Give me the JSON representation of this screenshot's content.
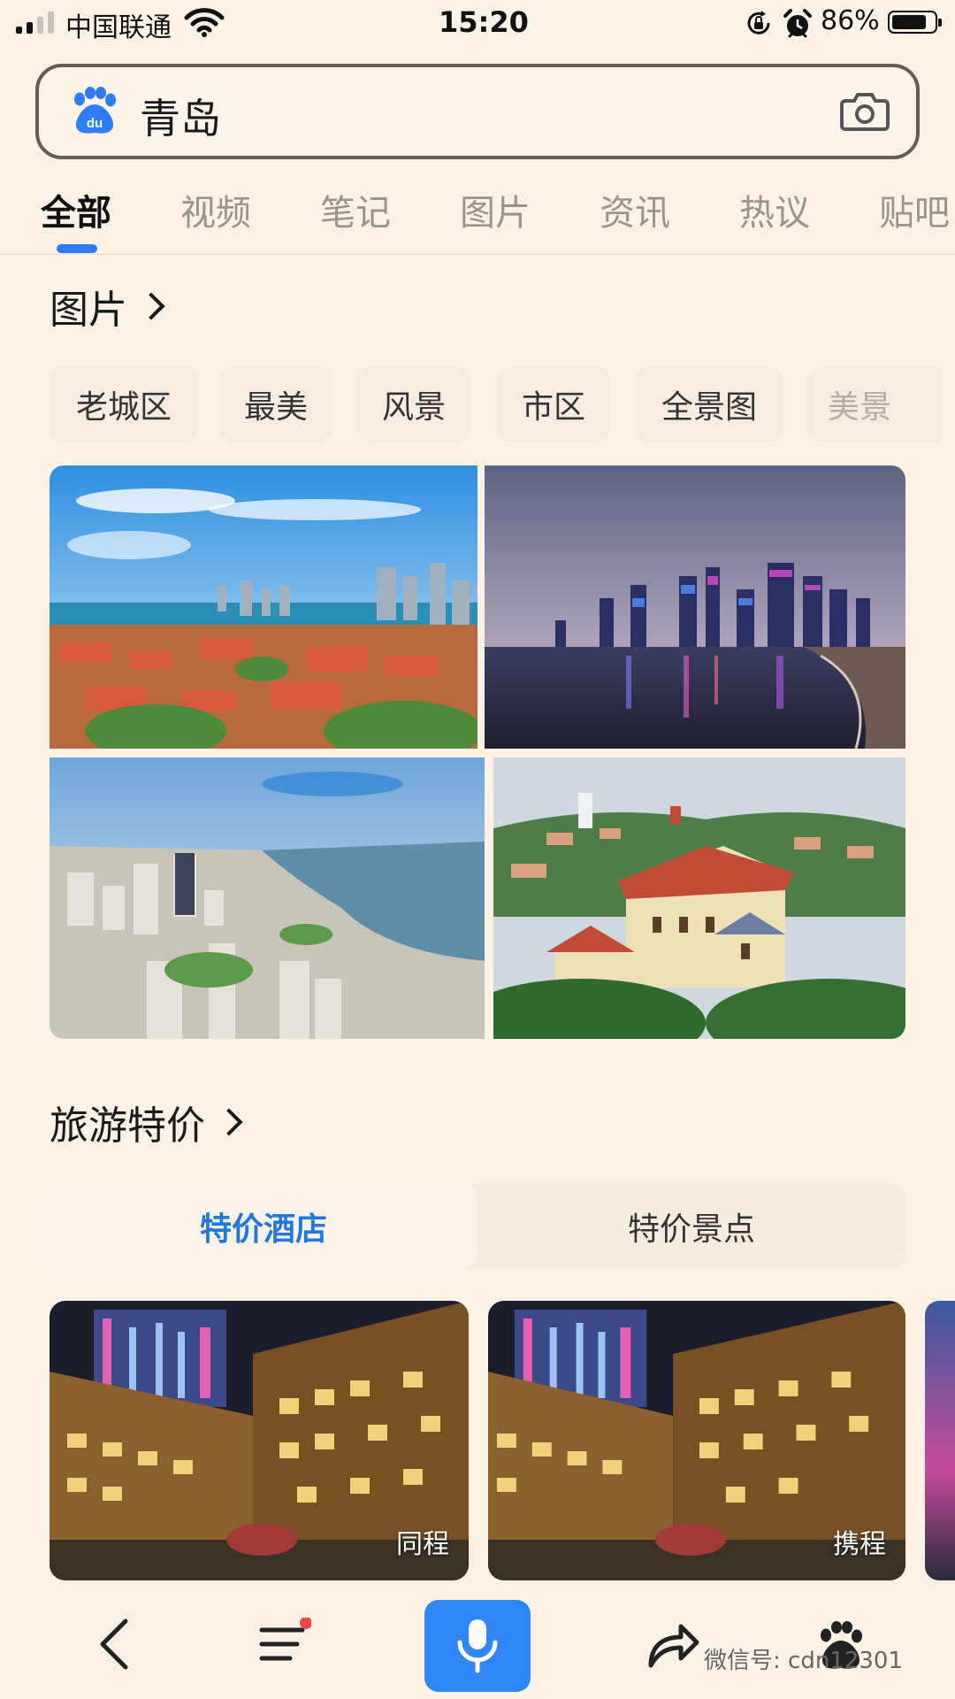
{
  "status_bar": {
    "carrier": "中国联通",
    "time": "15:20",
    "battery_percent": "86%",
    "battery_level": 0.86
  },
  "search": {
    "query": "青岛"
  },
  "tabs": [
    {
      "label": "全部",
      "active": true
    },
    {
      "label": "视频"
    },
    {
      "label": "笔记"
    },
    {
      "label": "图片"
    },
    {
      "label": "资讯"
    },
    {
      "label": "热议"
    },
    {
      "label": "贴吧"
    }
  ],
  "images_section": {
    "title": "图片",
    "chips": [
      "老城区",
      "最美",
      "风景",
      "市区",
      "全景图",
      "美景"
    ]
  },
  "travel_section": {
    "title": "旅游特价",
    "tabs": [
      {
        "label": "特价酒店",
        "active": true
      },
      {
        "label": "特价景点"
      }
    ],
    "hotels": [
      {
        "provider": "同程"
      },
      {
        "provider": "携程"
      }
    ]
  },
  "watermark": "微信号: cdn12301",
  "colors": {
    "background": "#fbf2e5",
    "accent": "#2f7df6",
    "active_tab_text": "#2277dd",
    "notification_dot": "#f04848"
  },
  "icons": [
    "signal-icon",
    "wifi-icon",
    "rotation-lock-icon",
    "alarm-icon",
    "battery-icon",
    "baidu-paw-icon",
    "camera-icon",
    "back-icon",
    "menu-icon",
    "mic-icon",
    "share-icon",
    "paw-icon"
  ]
}
